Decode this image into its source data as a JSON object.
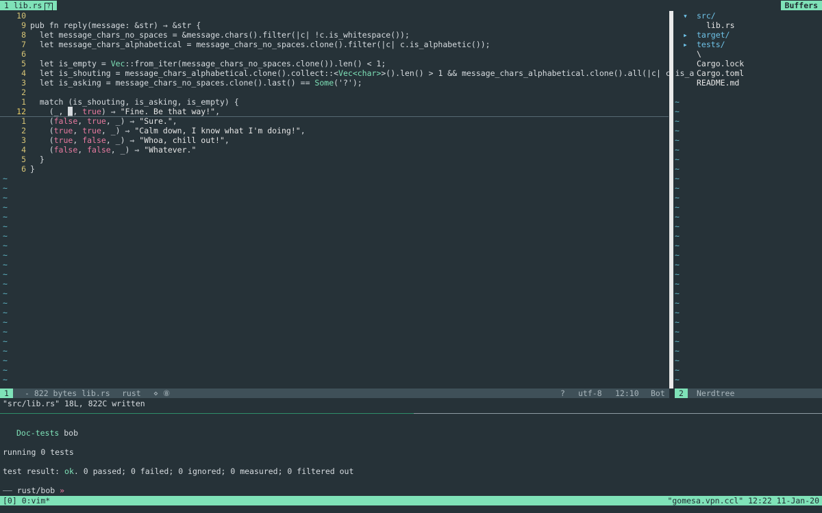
{
  "tabline": {
    "active_tab": "1 lib.rs",
    "tab_modified_icon": "?",
    "buffers_label": "Buffers"
  },
  "editor": {
    "lines": [
      {
        "num": "10",
        "text": ""
      },
      {
        "num": "9",
        "text": "pub fn reply(message: &str) → &str {"
      },
      {
        "num": "8",
        "text": "  let message_chars_no_spaces = &message.chars().filter(|c| !c.is_whitespace());"
      },
      {
        "num": "7",
        "text": "  let message_chars_alphabetical = message_chars_no_spaces.clone().filter(|c| c.is_alphabetic());"
      },
      {
        "num": "6",
        "text": ""
      },
      {
        "num": "5",
        "text": "  let is_empty = Vec::from_iter(message_chars_no_spaces.clone()).len() < 1;"
      },
      {
        "num": "4",
        "text": "  let is_shouting = message_chars_alphabetical.clone().collect::<Vec<char>>().len() > 1 && message_chars_alphabetical.clone().all(|c| c.is_a"
      },
      {
        "num": "3",
        "text": "  let is_asking = message_chars_no_spaces.clone().last() == Some('?');"
      },
      {
        "num": "2",
        "text": ""
      },
      {
        "num": "1",
        "text": "  match (is_shouting, is_asking, is_empty) {"
      },
      {
        "num": "12",
        "text": "    (_, _, true) ⇒ \"Fine. Be that way!\","
      },
      {
        "num": "1",
        "text": "    (false, true, _) ⇒ \"Sure.\","
      },
      {
        "num": "2",
        "text": "    (true, true, _) ⇒ \"Calm down, I know what I'm doing!\","
      },
      {
        "num": "3",
        "text": "    (true, false, _) ⇒ \"Whoa, chill out!\","
      },
      {
        "num": "4",
        "text": "    (false, false, _) ⇒ \"Whatever.\""
      },
      {
        "num": "5",
        "text": "  }"
      },
      {
        "num": "6",
        "text": "}"
      }
    ],
    "tilde": "~"
  },
  "nerdtree": {
    "items": [
      {
        "arrow": "▾",
        "label": "src/",
        "kind": "dir"
      },
      {
        "arrow": "",
        "label": "lib.rs",
        "kind": "file"
      },
      {
        "arrow": "▸",
        "label": "target/",
        "kind": "dir"
      },
      {
        "arrow": "▸",
        "label": "tests/",
        "kind": "dir"
      },
      {
        "arrow": "",
        "label": "\\",
        "kind": "file"
      },
      {
        "arrow": "",
        "label": "Cargo.lock",
        "kind": "file"
      },
      {
        "arrow": "",
        "label": "Cargo.toml",
        "kind": "file"
      },
      {
        "arrow": "",
        "label": "README.md",
        "kind": "file"
      }
    ]
  },
  "statusline": {
    "win_num_left": "1",
    "file_info": "- 822 bytes lib.rs",
    "filetype": "rust",
    "git_info": "⋄ ⑧",
    "help_icon": "?",
    "encoding": "utf-8",
    "position": "12:10",
    "scroll": "Bot",
    "win_num_right": "2",
    "right_name": "Nerdtree"
  },
  "message": "\"src/lib.rs\" 18L, 822C written",
  "terminal": {
    "doc_tests_label": "Doc-tests",
    "doc_tests_crate": "bob",
    "running": "running 0 tests",
    "result_prefix": "test result: ",
    "result_ok": "ok",
    "result_rest": ". 0 passed; 0 failed; 0 ignored; 0 measured; 0 filtered out",
    "prompt_dash": "—— ",
    "prompt_path": "rust/bob",
    "prompt_arrow": " »"
  },
  "tmux": {
    "left": "[0] 0:vim*",
    "right": "\"gomesa.vpn.ccl\" 12:22 11-Jan-20"
  },
  "colors": {
    "background": "#263238",
    "accent_green": "#7fe2b8",
    "line_number": "#d6c476",
    "directory": "#6fc3e8",
    "boolean": "#e87aa0"
  }
}
